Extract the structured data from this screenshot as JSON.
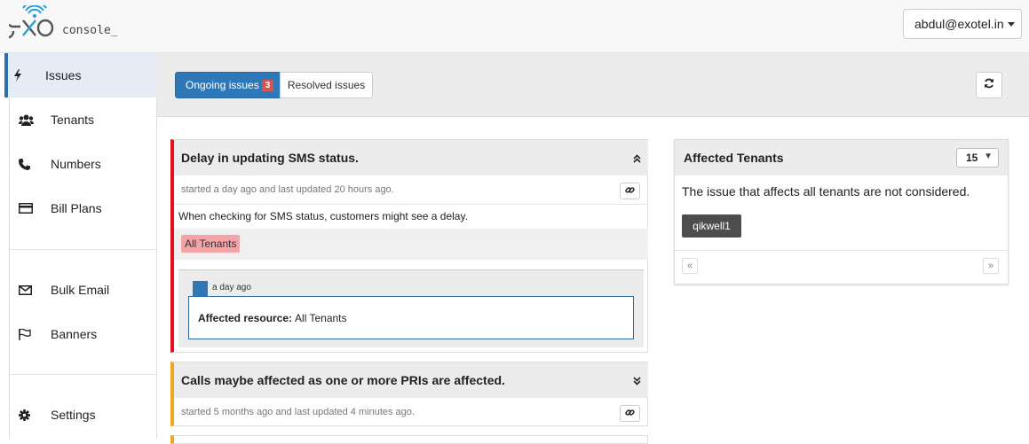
{
  "app": {
    "logo_text": "console_"
  },
  "header": {
    "user_label": "abdul@exotel.in"
  },
  "sidebar": {
    "items": [
      {
        "label": "Issues",
        "icon": "bolt-icon"
      },
      {
        "label": "Tenants",
        "icon": "users-icon"
      },
      {
        "label": "Numbers",
        "icon": "phone-icon"
      },
      {
        "label": "Bill Plans",
        "icon": "credit-card-icon"
      },
      {
        "label": "Bulk Email",
        "icon": "envelope-icon"
      },
      {
        "label": "Banners",
        "icon": "flag-icon"
      },
      {
        "label": "Settings",
        "icon": "gear-icon"
      }
    ]
  },
  "filters": {
    "ongoing_label": "Ongoing issues",
    "ongoing_count": "3",
    "resolved_label": "Resolved issues"
  },
  "issues": [
    {
      "title": "Delay in updating SMS status.",
      "meta": "started a day ago and last updated 20 hours ago.",
      "description": "When checking for SMS status, customers might see a delay.",
      "tag": "All Tenants",
      "update": {
        "time": "a day ago",
        "label": "Affected resource:",
        "value": "All Tenants"
      },
      "severity_color": "#e3101d"
    },
    {
      "title": "Calls maybe affected as one or more PRIs are affected.",
      "meta": "started 5 months ago and last updated 4 minutes ago.",
      "severity_color": "#f2a61f"
    }
  ],
  "affected_tenants": {
    "title": "Affected Tenants",
    "page_size": "15",
    "note": "The issue that affects all tenants are not considered.",
    "tenants": [
      "qikwell1"
    ],
    "prev_label": "«",
    "next_label": "»"
  },
  "colors": {
    "accent": "#2f78b8",
    "danger": "#e3101d",
    "warning": "#f2a61f"
  }
}
